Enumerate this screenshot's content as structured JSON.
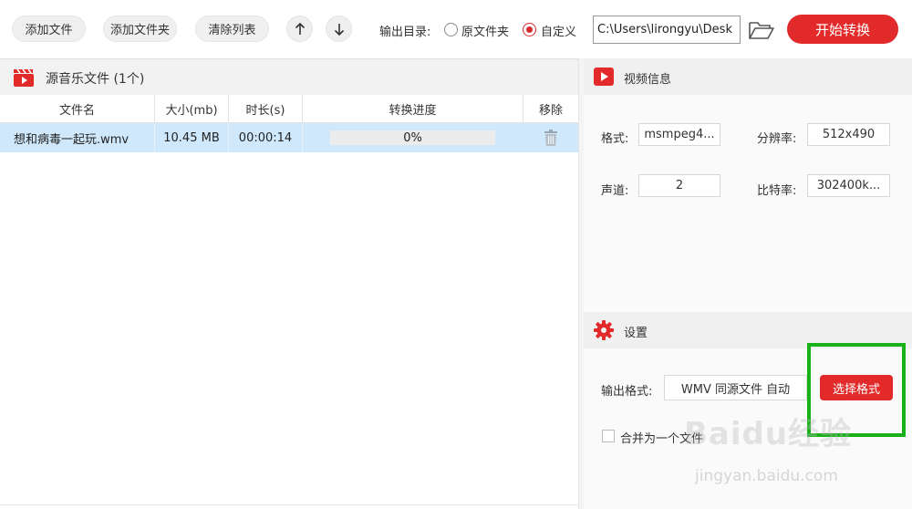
{
  "toolbar": {
    "add_file": "添加文件",
    "add_folder": "添加文件夹",
    "clear_list": "清除列表",
    "output_dir_label": "输出目录:",
    "option_source_folder": "原文件夹",
    "option_custom": "自定义",
    "selected_option": "自定义",
    "output_path": "C:\\Users\\lirongyu\\Desk",
    "start_convert": "开始转换"
  },
  "file_panel": {
    "title": "源音乐文件 (1个)",
    "columns": [
      "文件名",
      "大小(mb)",
      "时长(s)",
      "转换进度",
      "移除"
    ],
    "rows": [
      {
        "name": "想和病毒一起玩.wmv",
        "size": "10.45 MB",
        "duration": "00:00:14",
        "progress": "0%"
      }
    ]
  },
  "video_info": {
    "title": "视频信息",
    "format_label": "格式:",
    "format_value": "msmpeg4...",
    "resolution_label": "分辨率:",
    "resolution_value": "512x490",
    "channels_label": "声道:",
    "channels_value": "2",
    "bitrate_label": "比特率:",
    "bitrate_value": "302400k..."
  },
  "settings": {
    "title": "设置",
    "output_format_label": "输出格式:",
    "output_format_value": "WMV 同源文件 自动",
    "select_format_button": "选择格式",
    "merge_label": "合并为一个文件",
    "merge_checked": false
  },
  "watermark": {
    "brand": "Baidu经验",
    "url": "jingyan.baidu.com"
  },
  "colors": {
    "accent_red": "#e32a2a",
    "row_highlight": "#cfe8fb",
    "annotation_green": "#19b119"
  }
}
